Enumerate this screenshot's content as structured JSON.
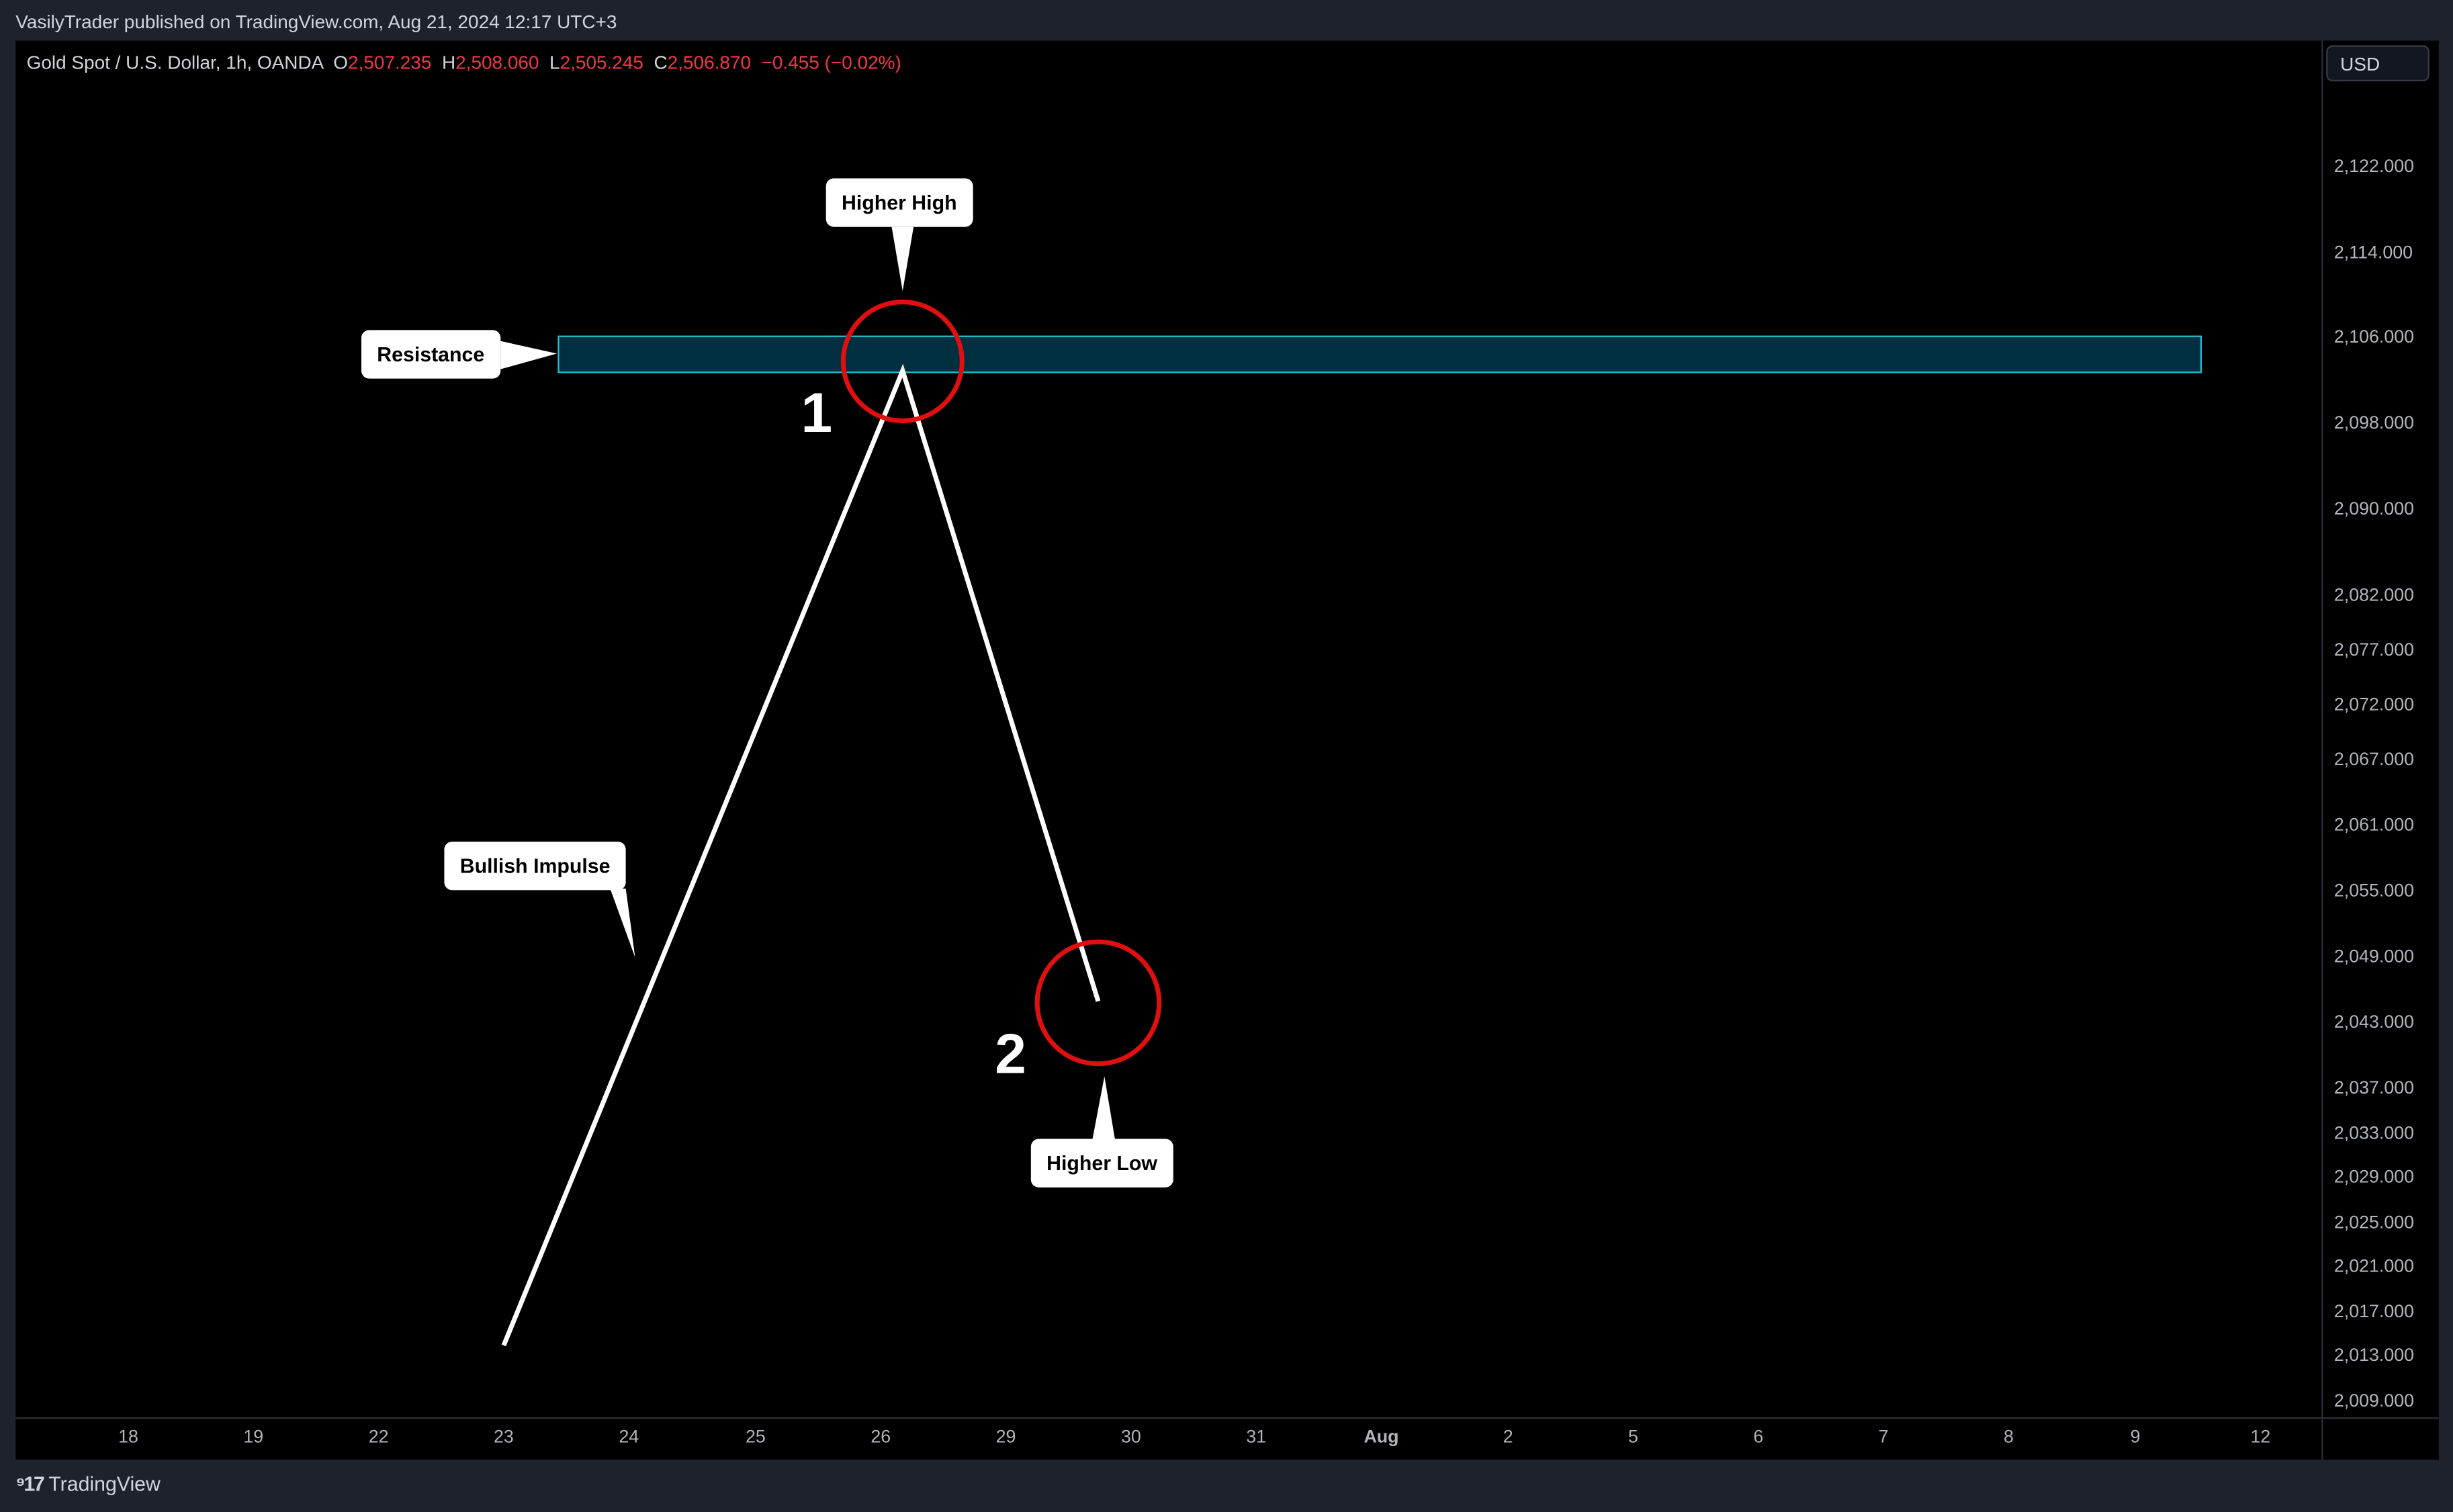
{
  "header": {
    "published": "VasilyTrader published on TradingView.com, Aug 21, 2024 12:17 UTC+3"
  },
  "legend": {
    "symbol": "Gold Spot / U.S. Dollar, 1h, OANDA",
    "o_label": "O",
    "o": "2,507.235",
    "h_label": "H",
    "h": "2,508.060",
    "l_label": "L",
    "l": "2,505.245",
    "c_label": "C",
    "c": "2,506.870",
    "change": "−0.455 (−0.02%)"
  },
  "currency": "USD",
  "price_axis": [
    "2,122.000",
    "2,114.000",
    "2,106.000",
    "2,098.000",
    "2,090.000",
    "2,082.000",
    "2,077.000",
    "2,072.000",
    "2,067.000",
    "2,061.000",
    "2,055.000",
    "2,049.000",
    "2,043.000",
    "2,037.000",
    "2,033.000",
    "2,029.000",
    "2,025.000",
    "2,021.000",
    "2,017.000",
    "2,013.000",
    "2,009.000"
  ],
  "time_axis": [
    "18",
    "19",
    "22",
    "23",
    "24",
    "25",
    "26",
    "29",
    "30",
    "31",
    "Aug",
    "2",
    "5",
    "6",
    "7",
    "8",
    "9",
    "12"
  ],
  "annotations": {
    "higher_high": "Higher High",
    "resistance": "Resistance",
    "bullish_impulse": "Bullish Impulse",
    "higher_low": "Higher Low",
    "point1": "1",
    "point2": "2"
  },
  "colors": {
    "background": "#000000",
    "zone_fill": "#00303f",
    "zone_border": "#2ab8d0",
    "circle": "#e01010",
    "line": "#ffffff",
    "down": "#f23645"
  },
  "footer": {
    "brand": "TradingView"
  }
}
